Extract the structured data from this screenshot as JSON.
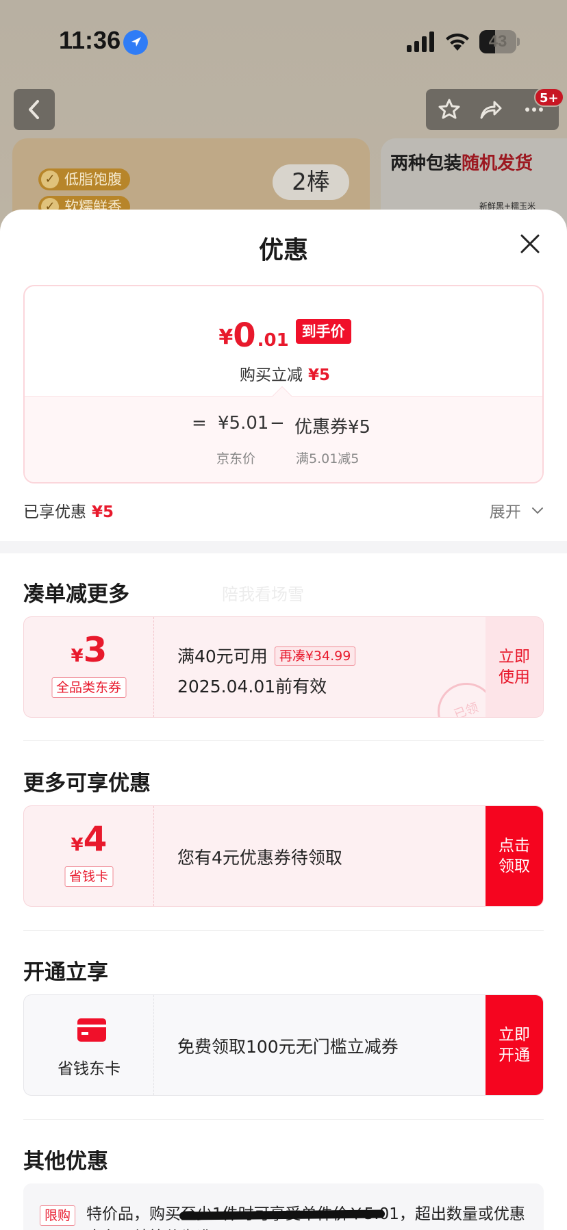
{
  "status_bar": {
    "time": "11:36",
    "battery": "43"
  },
  "nav": {
    "badge": "5+"
  },
  "product": {
    "feature_1": "低脂饱腹",
    "feature_2": "软糯鲜香",
    "stick_count": "2棒",
    "pack_text_normal": "两种包装",
    "pack_text_red": "随机发货",
    "pack_label": "新鲜黑+糯玉米"
  },
  "sheet": {
    "title": "优惠",
    "price": {
      "yen": "¥",
      "integer": "0",
      "decimal": ".01",
      "tag": "到手价",
      "instant_label": "购买立减",
      "instant_value": "¥5",
      "eq": "=",
      "jd_price": "¥5.01",
      "minus": "−",
      "coupon_label": "优惠券",
      "coupon_value": "¥5",
      "jd_price_label": "京东价",
      "coupon_rule": "满5.01减5"
    },
    "enjoyed_label": "已享优惠",
    "enjoyed_value": "¥5",
    "expand_label": "展开",
    "watermark": "陪我看场雪",
    "sections": {
      "more_order": {
        "title": "凑单减更多",
        "coupon": {
          "yen": "¥",
          "amount": "3",
          "tag": "全品类东券",
          "condition": "满40元可用",
          "chip": "再凑¥34.99",
          "expiry": "2025.04.01前有效",
          "action_line1": "立即",
          "action_line2": "使用",
          "stamp": "已领"
        }
      },
      "more_benefits": {
        "title": "更多可享优惠",
        "coupon": {
          "yen": "¥",
          "amount": "4",
          "tag": "省钱卡",
          "text": "您有4元优惠券待领取",
          "action_line1": "点击",
          "action_line2": "领取"
        }
      },
      "activate": {
        "title": "开通立享",
        "coupon": {
          "card_label": "省钱东卡",
          "text": "免费领取100元无门槛立减券",
          "action_line1": "立即",
          "action_line2": "开通"
        }
      },
      "other": {
        "title": "其他优惠",
        "tag": "限购",
        "text": "特价品，购买至少1件时可享受单件价￥5.01，超出数量或优惠库存以结算价为准"
      }
    }
  },
  "colors": {
    "brand_red": "#e8192c",
    "action_red": "#f5051f",
    "coupon_pink": "#fdf0f2"
  },
  "icons": {
    "back": "chevron-left-icon",
    "star": "star-icon",
    "share": "share-icon",
    "more": "more-icon",
    "close": "close-icon",
    "location": "location-arrow-icon",
    "card": "card-icon"
  }
}
